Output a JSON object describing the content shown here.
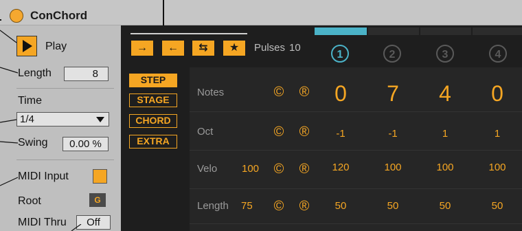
{
  "window": {
    "title": "ConChord"
  },
  "left_panel": {
    "play_label": "Play",
    "length_label": "Length",
    "length_value": "8",
    "time_label": "Time",
    "time_value": "1/4",
    "swing_label": "Swing",
    "swing_value": "0.00 %",
    "midi_input_label": "MIDI Input",
    "root_label": "Root",
    "root_value": "G",
    "midi_thru_label": "MIDI Thru",
    "midi_thru_value": "Off"
  },
  "toolbar": {
    "direction_buttons": [
      "→",
      "←",
      "⇆",
      "★"
    ],
    "pulses_label": "Pulses",
    "pulses_value": "10"
  },
  "tabs": [
    "STEP",
    "STAGE",
    "CHORD",
    "EXTRA"
  ],
  "steps": [
    "①",
    "②",
    "③",
    "④"
  ],
  "rows": {
    "notes": {
      "label": "Notes",
      "c": "©",
      "r": "®",
      "values": [
        "0",
        "7",
        "4",
        "0"
      ]
    },
    "oct": {
      "label": "Oct",
      "c": "©",
      "r": "®",
      "values": [
        "-1",
        "-1",
        "1",
        "1"
      ]
    },
    "velo": {
      "label": "Velo",
      "param": "100",
      "c": "©",
      "r": "®",
      "values": [
        "120",
        "100",
        "100",
        "100"
      ]
    },
    "length": {
      "label": "Length",
      "param": "75",
      "c": "©",
      "r": "®",
      "values": [
        "50",
        "50",
        "50",
        "50"
      ]
    }
  },
  "colors": {
    "accent": "#f5a623",
    "step_active": "#4bb3c8",
    "step_dim": "#5a5a5a",
    "panel": "#bfbfbf",
    "dark": "#1e1e1e"
  },
  "icons": {
    "play": "play-triangle-icon",
    "dropdown": "triangle-down-icon"
  }
}
